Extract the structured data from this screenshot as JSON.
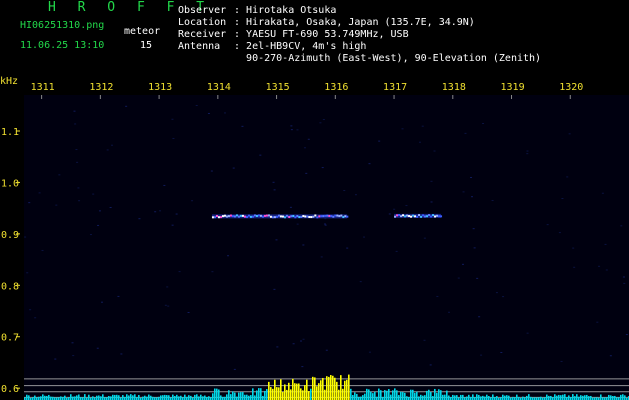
{
  "header": {
    "brand": "H R O F F T",
    "filename": "HI06251310.png",
    "meteor_label": "meteor",
    "datetime": "11.06.25 13:10",
    "meteor_count": "15"
  },
  "info": [
    {
      "key": "Observer",
      "value": "Hirotaka Otsuka"
    },
    {
      "key": "Location",
      "value": "Hirakata, Osaka, Japan (135.7E, 34.9N)"
    },
    {
      "key": "Receiver",
      "value": "YAESU FT-690 53.749MHz, USB"
    },
    {
      "key": "Antenna",
      "value": "2el-HB9CV, 4m's high"
    },
    {
      "key": "",
      "value": "90-270-Azimuth (East-West), 90-Elevation (Zenith)"
    }
  ],
  "colors": {
    "tick_label": "#f0e030",
    "plot_bg": "#000010",
    "grid_line": "#bbbbbb",
    "bars_yellow": "#ffff00",
    "bars_cyan": "#00d8e8"
  },
  "chart_data": {
    "type": "heatmap",
    "ylabel": "kHz",
    "x_ticks": [
      "1311",
      "1312",
      "1313",
      "1314",
      "1315",
      "1316",
      "1317",
      "1318",
      "1319",
      "1320"
    ],
    "x_range": [
      1310.7,
      1321.0
    ],
    "y_ticks": [
      "1.1",
      "1.0",
      "0.9",
      "0.8",
      "0.7",
      "0.6"
    ],
    "y_range": [
      0.577,
      1.17
    ],
    "echoes": [
      {
        "x_start": 1313.9,
        "x_end": 1315.2,
        "freq": 0.934
      },
      {
        "x_start": 1315.2,
        "x_end": 1316.2,
        "freq": 0.934
      },
      {
        "x_start": 1317.0,
        "x_end": 1317.8,
        "freq": 0.935
      }
    ],
    "baseline_levels": [
      0.618,
      0.605,
      0.593,
      0.582
    ]
  }
}
